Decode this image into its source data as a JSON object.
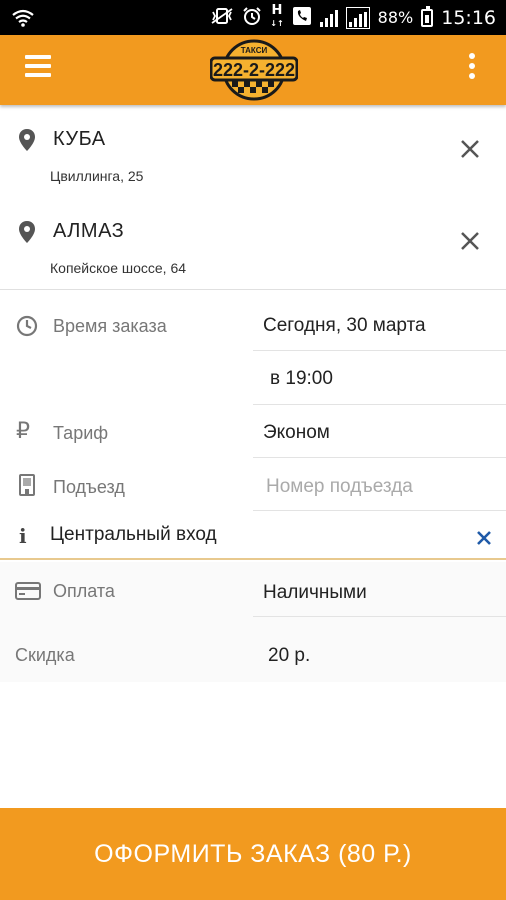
{
  "status_bar": {
    "battery": "88%",
    "time": "15:16",
    "network_label": "H"
  },
  "header": {
    "logo_number": "222-2-222",
    "logo_caption": "ТАКСИ",
    "brand_color": "#f29a1f"
  },
  "route": {
    "from": {
      "name": "КУБА",
      "address": "Цвиллинга, 25"
    },
    "to": {
      "name": "АЛМАЗ",
      "address": "Копейское шоссе, 64"
    }
  },
  "form": {
    "time": {
      "label": "Время заказа",
      "date": "Сегодня, 30 марта",
      "hour": "в 19:00"
    },
    "tariff": {
      "label": "Тариф",
      "value": "Эконом"
    },
    "entrance": {
      "label": "Подъезд",
      "placeholder": "Номер подъезда"
    },
    "comment": {
      "value": "Центральный вход"
    },
    "payment": {
      "label": "Оплата",
      "value": "Наличными"
    },
    "discount": {
      "label": "Скидка",
      "value": "20 р."
    }
  },
  "order_button": {
    "label": "ОФОРМИТЬ ЗАКАЗ (80 Р.)"
  },
  "icons": [
    "menu-icon",
    "more-icon",
    "location-pin-icon",
    "close-icon",
    "clock-icon",
    "ruble-icon",
    "building-icon",
    "info-icon",
    "credit-card-icon"
  ]
}
